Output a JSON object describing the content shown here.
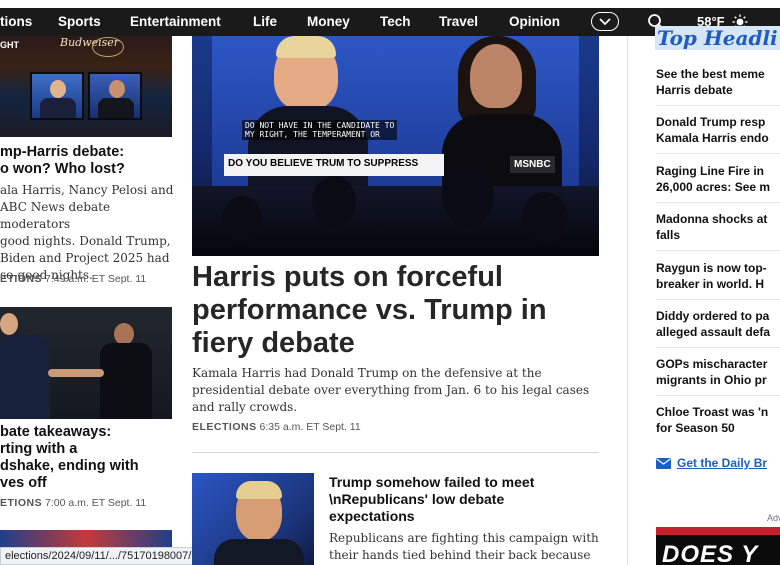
{
  "nav": {
    "items": [
      "tions",
      "Sports",
      "Entertainment",
      "Life",
      "Money",
      "Tech",
      "Travel",
      "Opinion"
    ],
    "temperature": "58°F"
  },
  "left": {
    "thumb1_tag": "GHT",
    "thumb1_banner": "Budweiser",
    "story1": {
      "headline_lines": [
        "mp-Harris debate:",
        "o won? Who lost?"
      ],
      "body_lines": [
        "ala Harris, Nancy Pelosi and",
        "ABC News debate moderators",
        "good nights. Donald Trump,",
        "Biden and Project 2025 had",
        "so-good nights."
      ],
      "category": "ETIONS",
      "time": "7:49 a.m. ET Sept. 11"
    },
    "story2": {
      "headline_lines": [
        "bate takeaways:",
        "rting with a",
        "dshake, ending with",
        "ves off"
      ],
      "category": "ETIONS",
      "time": "7:00 a.m. ET Sept. 11"
    },
    "status_url": "elections/2024/09/11/.../75170198007/"
  },
  "main": {
    "hero_caption_lines": [
      "DO NOT HAVE IN THE CANDIDATE TO",
      "MY RIGHT, THE TEMPERAMENT OR"
    ],
    "hero_lower_third": "DO YOU BELIEVE TRUM       TO SUPPRESS",
    "hero_network": "MSNBC",
    "headline_lines": [
      "Harris puts on forceful",
      "performance vs. Trump in",
      "fiery debate"
    ],
    "body": "Kamala Harris had Donald Trump on the defensive at the presidential debate over everything from Jan. 6 to his legal cases and rally crowds.",
    "category": "ELECTIONS",
    "time": "6:35 a.m. ET Sept. 11",
    "story2": {
      "headline_lines": [
        "Trump somehow failed to meet",
        "\\nRepublicans' low debate",
        "expectations"
      ],
      "body": "Republicans are fighting this campaign with their hands tied behind their back because of"
    }
  },
  "right": {
    "title": "Top Headli",
    "items": [
      [
        "See the best meme",
        "Harris debate"
      ],
      [
        "Donald Trump resp",
        "Kamala Harris endo"
      ],
      [
        "Raging Line Fire in",
        "26,000 acres: See m"
      ],
      [
        "Madonna shocks at",
        "falls"
      ],
      [
        "Raygun is now top-",
        "breaker in world. H"
      ],
      [
        "Diddy ordered to pa",
        "alleged assault defa"
      ],
      [
        "GOPs mischaracter",
        "migrants in Ohio pr"
      ],
      [
        "Chloe Troast was 'n",
        "for Season 50"
      ]
    ],
    "brief_label": "Get the Daily Br",
    "advert_label": "Adv",
    "ad_text": "DOES Y"
  },
  "colors": {
    "nav_bg": "#1a1a1a",
    "link_blue": "#1b5fc1",
    "headline_gray": "#262626"
  }
}
